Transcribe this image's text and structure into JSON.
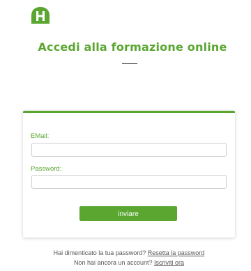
{
  "brand": {
    "logo_icon": "h-logo-icon",
    "logo_letter": "H",
    "color": "#5aa631"
  },
  "header": {
    "title": "Accedi alla formazione online"
  },
  "form": {
    "email_label": "EMail:",
    "email_value": "",
    "email_placeholder": "",
    "password_label": "Password:",
    "password_value": "",
    "password_placeholder": "",
    "submit_label": "inviare"
  },
  "footer": {
    "forgot_text": "Hai dimenticato la tua password?",
    "forgot_link": "Resetta la password",
    "signup_text": "Non hai ancora un account?",
    "signup_link": "Iscriviti ora"
  }
}
